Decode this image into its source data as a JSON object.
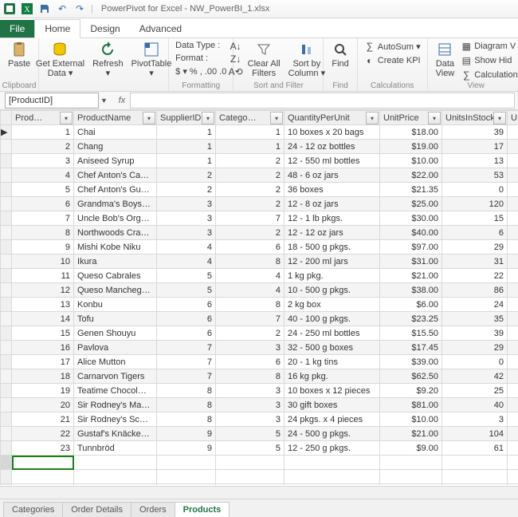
{
  "window": {
    "app_title": "PowerPivot for Excel - NW_PowerBI_1.xlsx"
  },
  "tabs": {
    "file": "File",
    "home": "Home",
    "design": "Design",
    "advanced": "Advanced"
  },
  "ribbon": {
    "clipboard": {
      "paste": "Paste",
      "label": "Clipboard"
    },
    "getdata": {
      "get": "Get External\nData ▾",
      "refresh": "Refresh\n▾",
      "pivot": "PivotTable\n▾"
    },
    "formatting": {
      "datatype": "Data Type :",
      "format": "Format :",
      "sym": "$ ▾  %  ,  .00  .0",
      "label": "Formatting"
    },
    "sortfilter": {
      "clear": "Clear All\nFilters",
      "sort": "Sort by\nColumn ▾",
      "label": "Sort and Filter"
    },
    "find": {
      "find": "Find",
      "label": "Find"
    },
    "calc": {
      "autosum": "AutoSum ▾",
      "kpi": "Create KPI",
      "label": "Calculations"
    },
    "view": {
      "dataview": "Data\nView",
      "diagram": "Diagram V",
      "showhide": "Show Hid",
      "calcarea": "Calculation",
      "label": "View"
    }
  },
  "namebox": {
    "value": "[ProductID]",
    "dd": "▼",
    "fx": "fx"
  },
  "columns": {
    "id": "Prod…",
    "name": "ProductName",
    "supp": "SupplierID",
    "cat": "Catego…",
    "qty": "QuantityPerUnit",
    "price": "UnitPrice",
    "stock": "UnitsInStock",
    "last": "U"
  },
  "rows": [
    {
      "id": 1,
      "name": "Chai",
      "supp": 1,
      "cat": 1,
      "qty": "10 boxes x 20 bags",
      "price": "$18.00",
      "stock": 39
    },
    {
      "id": 2,
      "name": "Chang",
      "supp": 1,
      "cat": 1,
      "qty": "24 - 12 oz bottles",
      "price": "$19.00",
      "stock": 17
    },
    {
      "id": 3,
      "name": "Aniseed Syrup",
      "supp": 1,
      "cat": 2,
      "qty": "12 - 550 ml bottles",
      "price": "$10.00",
      "stock": 13
    },
    {
      "id": 4,
      "name": "Chef Anton's Ca…",
      "supp": 2,
      "cat": 2,
      "qty": "48 - 6 oz jars",
      "price": "$22.00",
      "stock": 53
    },
    {
      "id": 5,
      "name": "Chef Anton's Gu…",
      "supp": 2,
      "cat": 2,
      "qty": "36 boxes",
      "price": "$21.35",
      "stock": 0
    },
    {
      "id": 6,
      "name": "Grandma's Boys…",
      "supp": 3,
      "cat": 2,
      "qty": "12 - 8 oz jars",
      "price": "$25.00",
      "stock": 120
    },
    {
      "id": 7,
      "name": "Uncle Bob's Org…",
      "supp": 3,
      "cat": 7,
      "qty": "12 - 1 lb pkgs.",
      "price": "$30.00",
      "stock": 15
    },
    {
      "id": 8,
      "name": "Northwoods Cra…",
      "supp": 3,
      "cat": 2,
      "qty": "12 - 12 oz jars",
      "price": "$40.00",
      "stock": 6
    },
    {
      "id": 9,
      "name": "Mishi Kobe Niku",
      "supp": 4,
      "cat": 6,
      "qty": "18 - 500 g pkgs.",
      "price": "$97.00",
      "stock": 29
    },
    {
      "id": 10,
      "name": "Ikura",
      "supp": 4,
      "cat": 8,
      "qty": "12 - 200 ml jars",
      "price": "$31.00",
      "stock": 31
    },
    {
      "id": 11,
      "name": "Queso Cabrales",
      "supp": 5,
      "cat": 4,
      "qty": "1 kg pkg.",
      "price": "$21.00",
      "stock": 22
    },
    {
      "id": 12,
      "name": "Queso Mancheg…",
      "supp": 5,
      "cat": 4,
      "qty": "10 - 500 g pkgs.",
      "price": "$38.00",
      "stock": 86
    },
    {
      "id": 13,
      "name": "Konbu",
      "supp": 6,
      "cat": 8,
      "qty": "2 kg box",
      "price": "$6.00",
      "stock": 24
    },
    {
      "id": 14,
      "name": "Tofu",
      "supp": 6,
      "cat": 7,
      "qty": "40 - 100 g pkgs.",
      "price": "$23.25",
      "stock": 35
    },
    {
      "id": 15,
      "name": "Genen Shouyu",
      "supp": 6,
      "cat": 2,
      "qty": "24 - 250 ml bottles",
      "price": "$15.50",
      "stock": 39
    },
    {
      "id": 16,
      "name": "Pavlova",
      "supp": 7,
      "cat": 3,
      "qty": "32 - 500 g boxes",
      "price": "$17.45",
      "stock": 29
    },
    {
      "id": 17,
      "name": "Alice Mutton",
      "supp": 7,
      "cat": 6,
      "qty": "20 - 1 kg tins",
      "price": "$39.00",
      "stock": 0
    },
    {
      "id": 18,
      "name": "Carnarvon Tigers",
      "supp": 7,
      "cat": 8,
      "qty": "16 kg pkg.",
      "price": "$62.50",
      "stock": 42
    },
    {
      "id": 19,
      "name": "Teatime Chocol…",
      "supp": 8,
      "cat": 3,
      "qty": "10 boxes x 12 pieces",
      "price": "$9.20",
      "stock": 25
    },
    {
      "id": 20,
      "name": "Sir Rodney's Ma…",
      "supp": 8,
      "cat": 3,
      "qty": "30 gift boxes",
      "price": "$81.00",
      "stock": 40
    },
    {
      "id": 21,
      "name": "Sir Rodney's Sco…",
      "supp": 8,
      "cat": 3,
      "qty": "24 pkgs. x 4 pieces",
      "price": "$10.00",
      "stock": 3
    },
    {
      "id": 22,
      "name": "Gustaf's Knäcke…",
      "supp": 9,
      "cat": 5,
      "qty": "24 - 500 g pkgs.",
      "price": "$21.00",
      "stock": 104
    },
    {
      "id": 23,
      "name": "Tunnbröd",
      "supp": 9,
      "cat": 5,
      "qty": "12 - 250 g pkgs.",
      "price": "$9.00",
      "stock": 61
    }
  ],
  "sheets": {
    "s1": "Categories",
    "s2": "Order Details",
    "s3": "Orders",
    "s4": "Products"
  }
}
